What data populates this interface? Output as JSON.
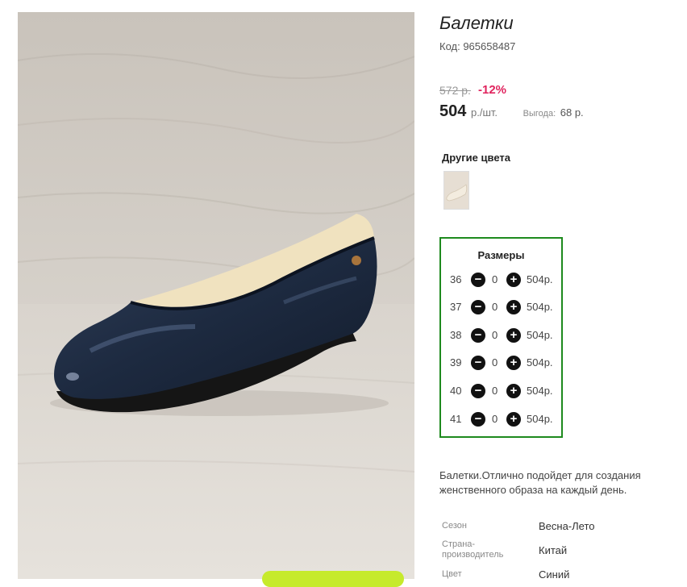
{
  "product": {
    "title": "Балетки",
    "code": "Код: 965658487",
    "image_alt": "navy-patent-ballet-flat"
  },
  "pricing": {
    "old_price": "572 р.",
    "discount": "-12%",
    "price": "504",
    "unit": "р./шт.",
    "savings_label": "Выгода:",
    "savings_value": "68 р."
  },
  "colors": {
    "label": "Другие цвета"
  },
  "sizes": {
    "title": "Размеры",
    "rows": [
      {
        "size": "36",
        "qty": "0",
        "price": "504р."
      },
      {
        "size": "37",
        "qty": "0",
        "price": "504р."
      },
      {
        "size": "38",
        "qty": "0",
        "price": "504р."
      },
      {
        "size": "39",
        "qty": "0",
        "price": "504р."
      },
      {
        "size": "40",
        "qty": "0",
        "price": "504р."
      },
      {
        "size": "41",
        "qty": "0",
        "price": "504р."
      }
    ],
    "minus_symbol": "−",
    "plus_symbol": "+"
  },
  "description": "Балетки.Отлично подойдет для создания женственного образа на каждый день.",
  "attributes": [
    {
      "label": "Сезон",
      "value": "Весна-Лето"
    },
    {
      "label": "Страна-производитель",
      "value": "Китай"
    },
    {
      "label": "Цвет",
      "value": "Синий"
    }
  ],
  "colors_palette": {
    "accent_green": "#1e8a1e",
    "discount_red": "#e0245e",
    "button_lime": "#c6ea2c"
  }
}
